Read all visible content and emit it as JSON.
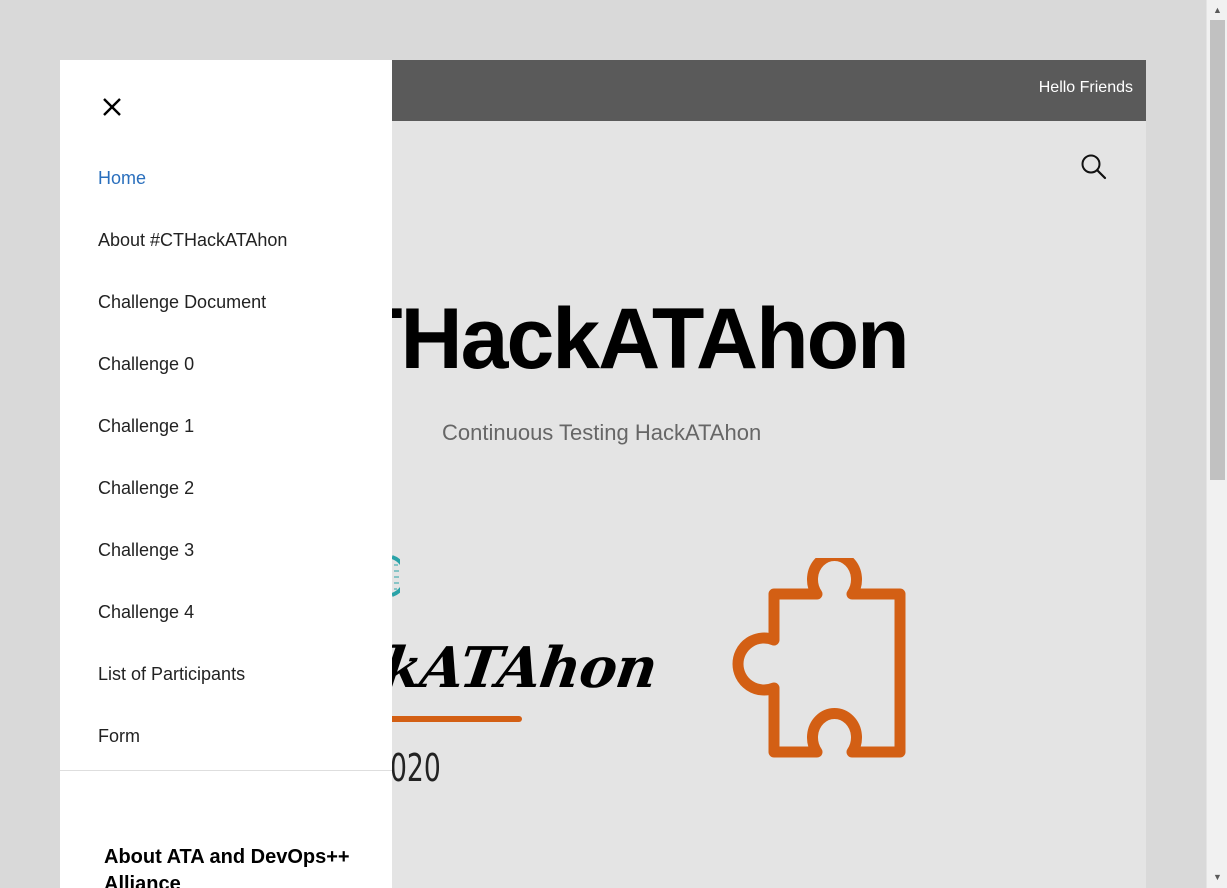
{
  "topbar": {
    "text": "Hello Friends"
  },
  "header": {
    "search_icon": "search-icon"
  },
  "site": {
    "title": "THackATAhon",
    "tagline": "Continuous Testing HackATAhon"
  },
  "logo": {
    "script_text": "ckATAhon",
    "year_text": "020",
    "accent_color": "#d35f14"
  },
  "drawer": {
    "close_icon": "close-icon",
    "menu": [
      {
        "label": "Home",
        "active": true
      },
      {
        "label": "About #CTHackATAhon"
      },
      {
        "label": "Challenge Document"
      },
      {
        "label": "Challenge 0"
      },
      {
        "label": "Challenge 1"
      },
      {
        "label": "Challenge 2"
      },
      {
        "label": "Challenge 3"
      },
      {
        "label": "Challenge 4"
      },
      {
        "label": "List of Participants"
      },
      {
        "label": "Form"
      }
    ],
    "widget_heading": "About ATA and DevOps++ Alliance",
    "active_color": "#2a6fbd"
  }
}
